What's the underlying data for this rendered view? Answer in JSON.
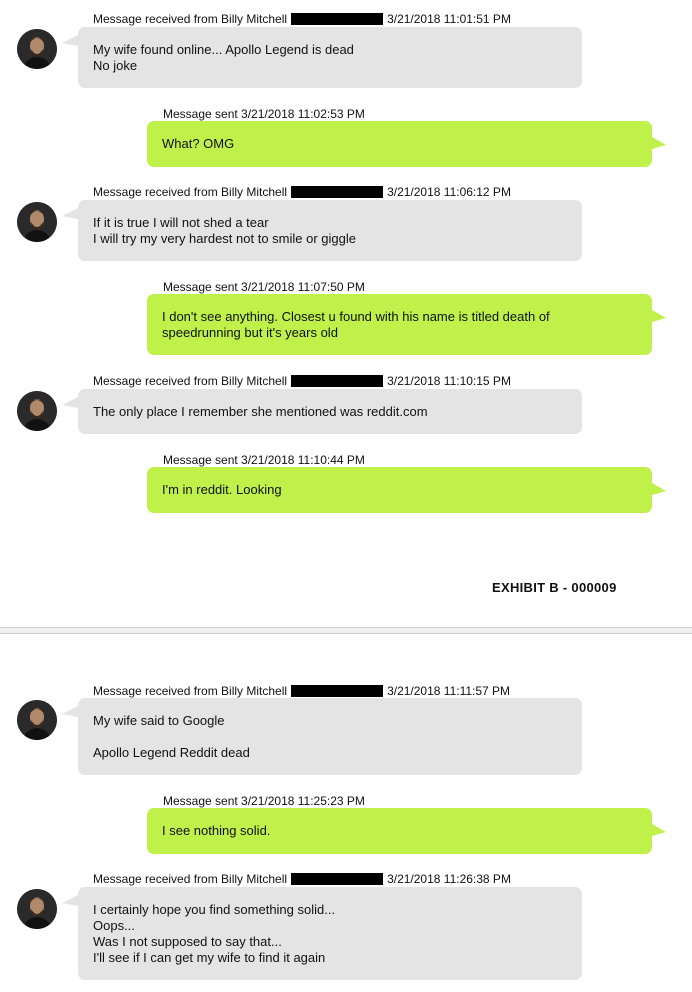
{
  "exhibit_label": "EXHIBIT B - 000009",
  "icons": {
    "avatar": "contact-avatar-icon"
  },
  "colors": {
    "received_bubble": "#e4e4e4",
    "sent_bubble": "#c0f04a",
    "redaction": "#000000"
  },
  "messages": [
    {
      "direction": "received",
      "header_prefix": "Message received from Billy Mitchell",
      "header_time": "3/21/2018 11:01:51 PM",
      "text": "My wife found online... Apollo Legend is dead\nNo joke"
    },
    {
      "direction": "sent",
      "header": "Message sent 3/21/2018 11:02:53 PM",
      "text": "What? OMG"
    },
    {
      "direction": "received",
      "header_prefix": "Message received from Billy Mitchell",
      "header_time": "3/21/2018 11:06:12 PM",
      "text": "If it is true I will not shed a tear\nI will try my very hardest not to smile or giggle"
    },
    {
      "direction": "sent",
      "header": "Message sent 3/21/2018 11:07:50 PM",
      "text": "I don't see anything. Closest u found with his name is titled death of\nspeedrunning but it's years old"
    },
    {
      "direction": "received",
      "header_prefix": "Message received from Billy Mitchell",
      "header_time": "3/21/2018 11:10:15 PM",
      "text": "The only place I remember she mentioned was reddit.com"
    },
    {
      "direction": "sent",
      "header": "Message sent 3/21/2018 11:10:44 PM",
      "text": "I'm in reddit. Looking"
    },
    {
      "direction": "received",
      "header_prefix": "Message received from Billy Mitchell",
      "header_time": "3/21/2018 11:11:57 PM",
      "text": "My wife said to Google\n\n Apollo Legend Reddit dead"
    },
    {
      "direction": "sent",
      "header": "Message sent 3/21/2018 11:25:23 PM",
      "text": "I see nothing solid."
    },
    {
      "direction": "received",
      "header_prefix": "Message received from Billy Mitchell",
      "header_time": "3/21/2018 11:26:38 PM",
      "text": "I certainly hope you find something solid...\n Oops...\nWas I not supposed to say that...\nI'll see if I can get my wife to find it again"
    }
  ]
}
